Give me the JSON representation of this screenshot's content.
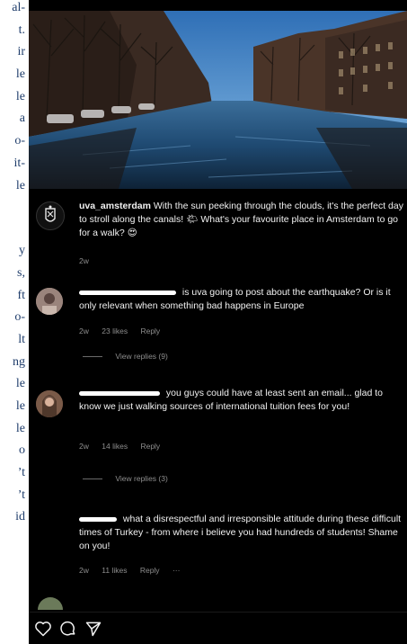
{
  "left_column_fragments": [
    "al-",
    "t.",
    "ir",
    "le",
    "le",
    "a",
    "o-",
    "it-",
    "le",
    "y",
    "s,",
    "ft",
    "o-",
    "lt",
    "ng",
    "le",
    "le",
    "le",
    "o",
    "’t",
    "’t",
    "id"
  ],
  "post": {
    "author": "uva_amsterdam",
    "caption": "With the sun peeking through the clouds, it's the perfect day to stroll along the canals! 🌤 What's your favourite place in Amsterdam to go for a walk? 😍",
    "time": "2w"
  },
  "comments": [
    {
      "text": "is uva going to post about the earthquake? Or is it only relevant when something bad happens in Europe",
      "time": "2w",
      "likes": "23 likes",
      "reply": "Reply",
      "view_replies": "View replies (9)"
    },
    {
      "text": "you guys could have at least sent an email... glad to know we just walking sources of international tuition fees for you!",
      "time": "2w",
      "likes": "14 likes",
      "reply": "Reply",
      "view_replies": "View replies (3)"
    },
    {
      "text": "what a disrespectful and irresponsible attitude during these difficult times of Turkey - from where i believe you had hundreds of students! Shame on you!",
      "time": "2w",
      "likes": "11 likes",
      "reply": "Reply",
      "more": "···"
    }
  ],
  "actions": {
    "like_icon": "heart-icon",
    "comment_icon": "comment-bubble-icon",
    "share_icon": "paper-plane-icon"
  },
  "colors": {
    "background": "#000000",
    "text": "#f2f2f2",
    "muted": "#8e8e8e",
    "sidebar_text": "#1f3d6b"
  }
}
